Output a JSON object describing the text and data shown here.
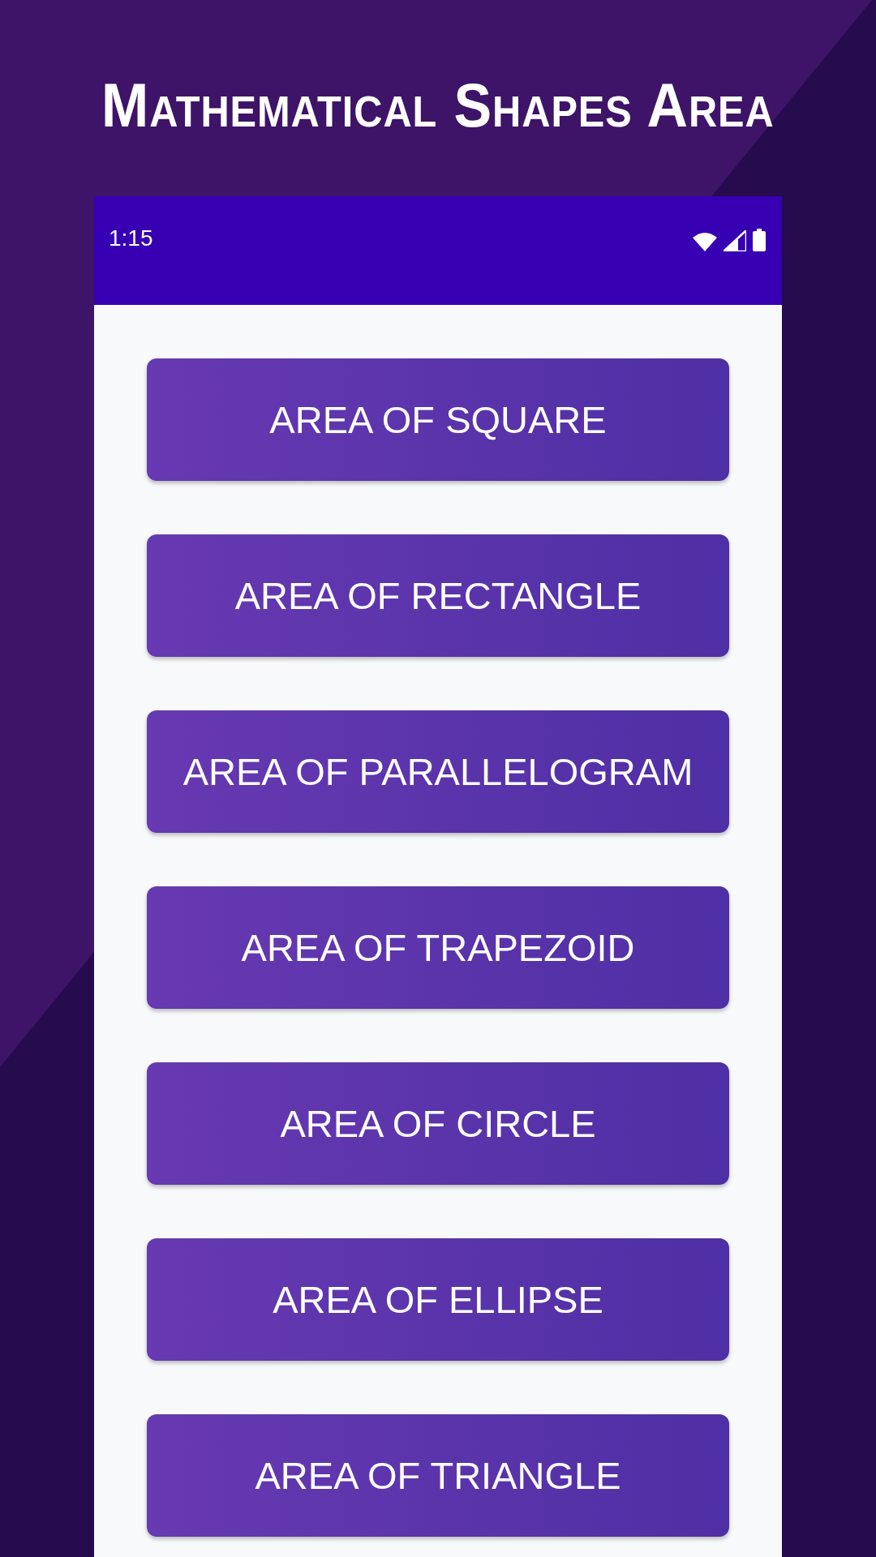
{
  "title": "Mathematical Shapes Area",
  "status_bar": {
    "time": "1:15"
  },
  "buttons": [
    {
      "label": "AREA OF SQUARE"
    },
    {
      "label": "AREA OF RECTANGLE"
    },
    {
      "label": "AREA OF PARALLELOGRAM"
    },
    {
      "label": "AREA OF TRAPEZOID"
    },
    {
      "label": "AREA OF CIRCLE"
    },
    {
      "label": "AREA OF ELLIPSE"
    },
    {
      "label": "AREA OF TRIANGLE"
    }
  ]
}
